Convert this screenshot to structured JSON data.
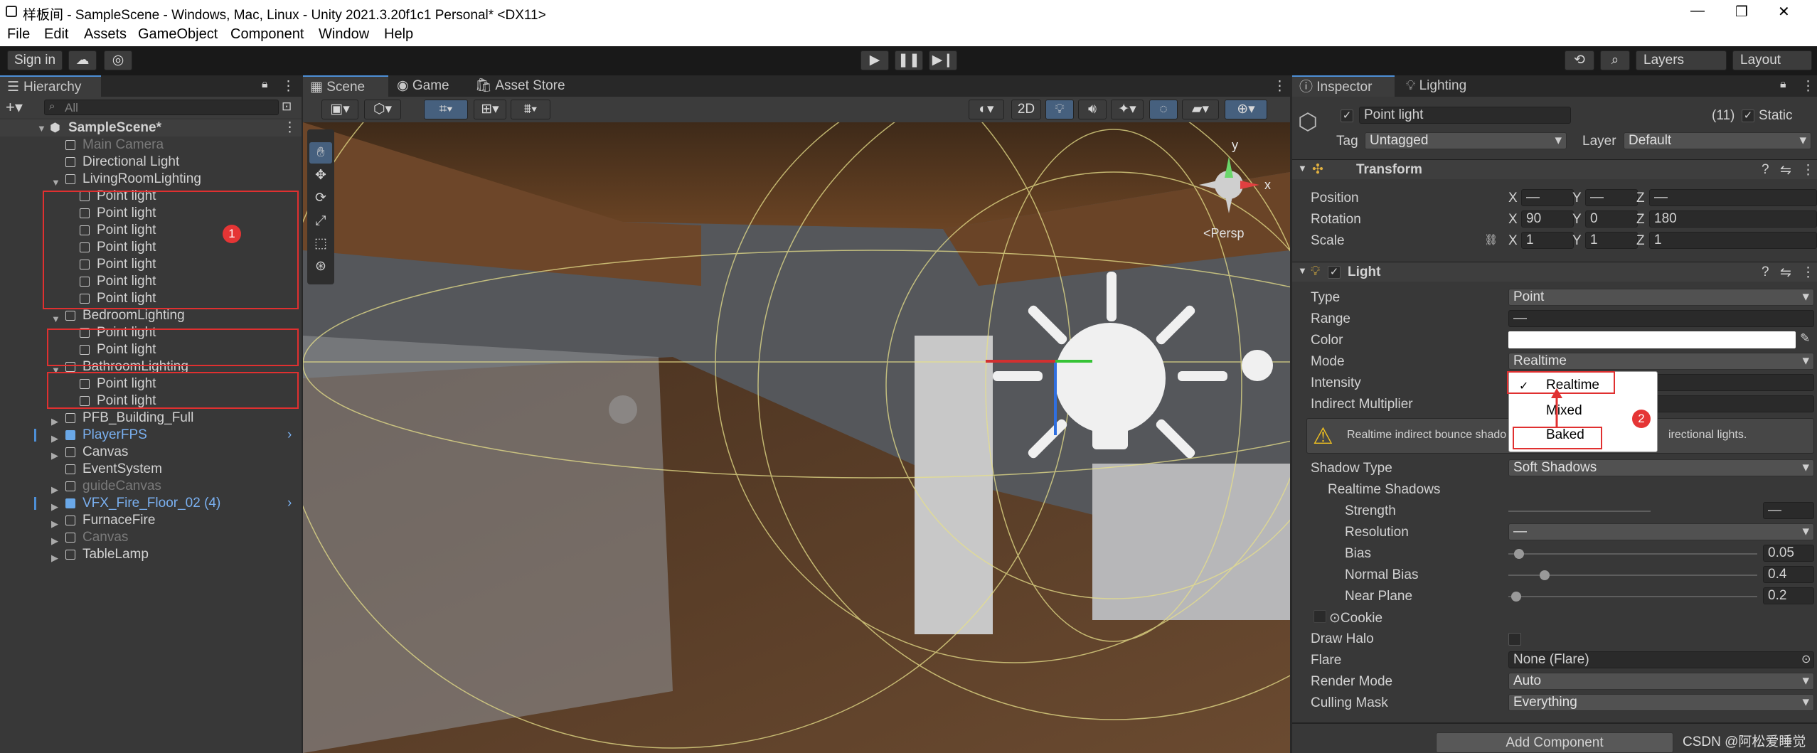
{
  "window": {
    "title": "样板间 - SampleScene - Windows, Mac, Linux - Unity 2021.3.20f1c1 Personal* <DX11>",
    "minimize": "—",
    "maximize": "❐",
    "close": "✕"
  },
  "menu": [
    "File",
    "Edit",
    "Assets",
    "GameObject",
    "Component",
    "Window",
    "Help"
  ],
  "toolbar": {
    "signin": "Sign in",
    "layers": "Layers",
    "layout": "Layout"
  },
  "hierarchy": {
    "tab": "Hierarchy",
    "search_placeholder": "All",
    "scene": "SampleScene*",
    "rows": [
      {
        "label": "Main Camera",
        "indent": 1,
        "style": "dim"
      },
      {
        "label": "Directional Light",
        "indent": 1,
        "style": ""
      },
      {
        "label": "LivingRoomLighting",
        "indent": 1,
        "style": "",
        "expanded": true
      },
      {
        "label": "Point light",
        "indent": 2,
        "style": ""
      },
      {
        "label": "Point light",
        "indent": 2,
        "style": ""
      },
      {
        "label": "Point light",
        "indent": 2,
        "style": ""
      },
      {
        "label": "Point light",
        "indent": 2,
        "style": ""
      },
      {
        "label": "Point light",
        "indent": 2,
        "style": ""
      },
      {
        "label": "Point light",
        "indent": 2,
        "style": ""
      },
      {
        "label": "Point light",
        "indent": 2,
        "style": ""
      },
      {
        "label": "BedroomLighting",
        "indent": 1,
        "style": "",
        "expanded": true
      },
      {
        "label": "Point light",
        "indent": 2,
        "style": ""
      },
      {
        "label": "Point light",
        "indent": 2,
        "style": ""
      },
      {
        "label": "BathroomLighting",
        "indent": 1,
        "style": "",
        "expanded": true
      },
      {
        "label": "Point light",
        "indent": 2,
        "style": ""
      },
      {
        "label": "Point light",
        "indent": 2,
        "style": ""
      },
      {
        "label": "PFB_Building_Full",
        "indent": 1,
        "style": "",
        "collapsed": true
      },
      {
        "label": "PlayerFPS",
        "indent": 1,
        "style": "blue",
        "collapsed": true
      },
      {
        "label": "Canvas",
        "indent": 1,
        "style": "",
        "collapsed": true
      },
      {
        "label": "EventSystem",
        "indent": 1,
        "style": ""
      },
      {
        "label": "guideCanvas",
        "indent": 1,
        "style": "dim",
        "collapsed": true
      },
      {
        "label": "VFX_Fire_Floor_02 (4)",
        "indent": 1,
        "style": "blue",
        "collapsed": true
      },
      {
        "label": "FurnaceFire",
        "indent": 1,
        "style": "",
        "collapsed": true
      },
      {
        "label": "Canvas",
        "indent": 1,
        "style": "dim",
        "collapsed": true
      },
      {
        "label": "TableLamp",
        "indent": 1,
        "style": "",
        "collapsed": true
      }
    ],
    "marker1": "1"
  },
  "scene": {
    "tabs": [
      "Scene",
      "Game",
      "Asset Store"
    ],
    "mode2d": "2D",
    "persp": "<Persp",
    "axis_y": "y",
    "axis_x": "x"
  },
  "inspector": {
    "tabs": [
      "Inspector",
      "Lighting"
    ],
    "object_name": "Point light",
    "count": "(11)",
    "static_label": "Static",
    "tag_label": "Tag",
    "tag_value": "Untagged",
    "layer_label": "Layer",
    "layer_value": "Default",
    "transform": {
      "title": "Transform",
      "position": "Position",
      "rotation": "Rotation",
      "scale": "Scale",
      "pos": [
        "—",
        "—",
        "—"
      ],
      "rot": [
        "90",
        "0",
        "180"
      ],
      "scl": [
        "1",
        "1",
        "1"
      ],
      "axes": [
        "X",
        "Y",
        "Z"
      ]
    },
    "light": {
      "title": "Light",
      "type_label": "Type",
      "type_value": "Point",
      "range_label": "Range",
      "range_value": "—",
      "color_label": "Color",
      "mode_label": "Mode",
      "mode_value": "Realtime",
      "intensity_label": "Intensity",
      "indirect_label": "Indirect Multiplier",
      "warning": "Realtime indirect bounce shadowing is not supported for Spot and Point lights, only for directional lights.",
      "warning_visible_left": "Realtime indirect bounce shado",
      "warning_visible_right": "irectional lights.",
      "shadow_type_label": "Shadow Type",
      "shadow_type_value": "Soft Shadows",
      "realtime_shadows": "Realtime Shadows",
      "strength": "Strength",
      "strength_value": "—",
      "resolution": "Resolution",
      "resolution_value": "—",
      "bias": "Bias",
      "bias_value": "0.05",
      "normal_bias": "Normal Bias",
      "normal_bias_value": "0.4",
      "near_plane": "Near Plane",
      "near_plane_value": "0.2",
      "cookie": "Cookie",
      "draw_halo": "Draw Halo",
      "flare": "Flare",
      "flare_value": "None (Flare)",
      "render_mode": "Render Mode",
      "render_mode_value": "Auto",
      "culling_mask": "Culling Mask",
      "culling_mask_value": "Everything"
    },
    "dropdown": {
      "options": [
        "Realtime",
        "Mixed",
        "Baked"
      ],
      "selected": "Realtime",
      "marker2": "2",
      "check": "✓"
    },
    "add_component": "Add Component"
  },
  "watermark": "CSDN @阿松爱睡觉",
  "colors": {
    "accent": "#4d8fd6",
    "redbox": "#e03030",
    "panel": "#383838"
  }
}
